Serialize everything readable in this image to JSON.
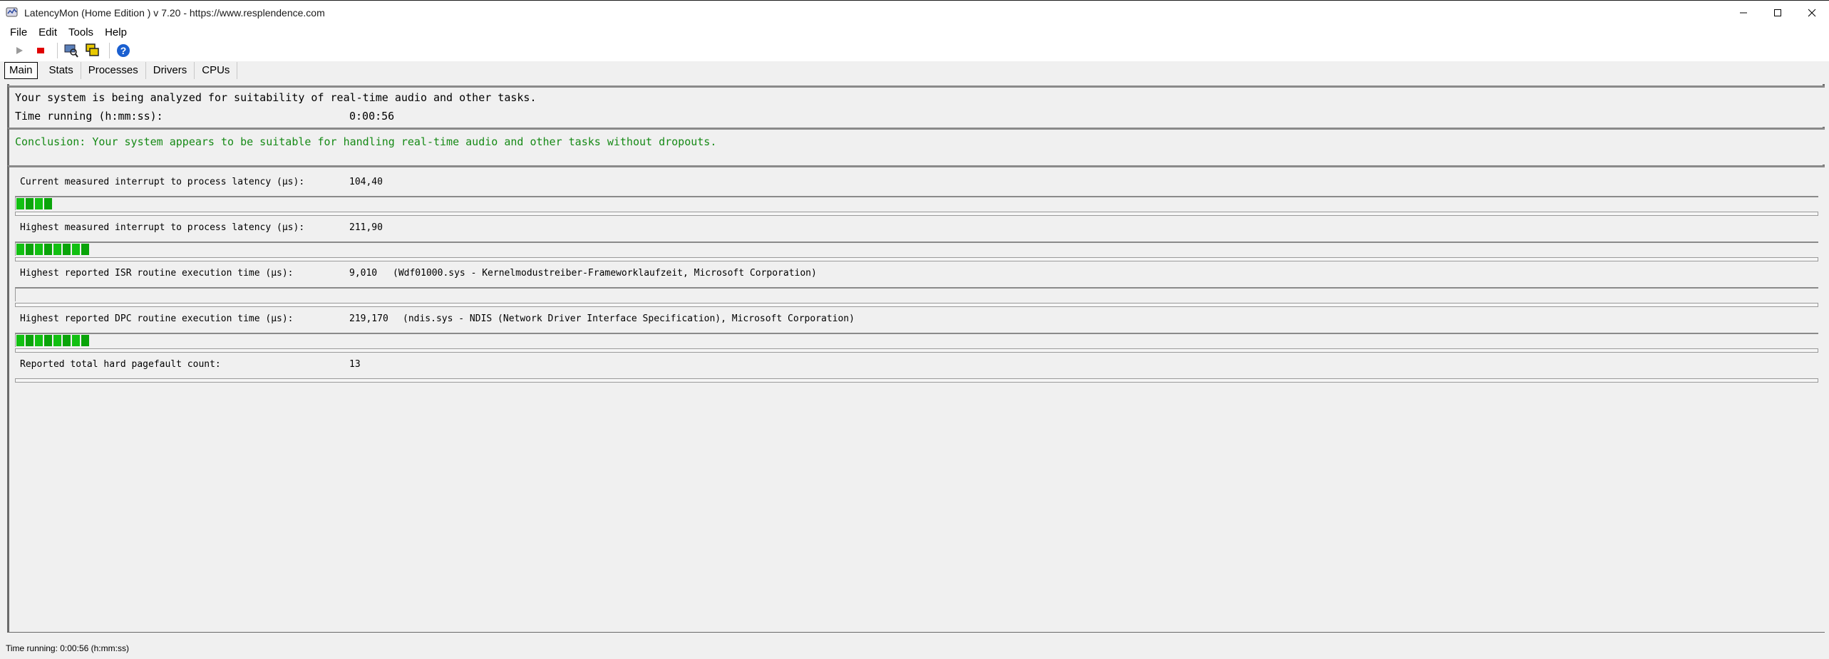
{
  "window": {
    "title": "LatencyMon  (Home Edition )  v 7.20 - https://www.resplendence.com",
    "app_icon": "latencymon-icon"
  },
  "menu": [
    "File",
    "Edit",
    "Tools",
    "Help"
  ],
  "toolbar": {
    "items": [
      "play-icon",
      "stop-icon",
      "monitor-icon",
      "windows-icon",
      "help-icon"
    ],
    "colors": {
      "stop": "#e00000",
      "help": "#1a5fd0"
    }
  },
  "tabs": [
    "Main",
    "Stats",
    "Processes",
    "Drivers",
    "CPUs"
  ],
  "main": {
    "status_line": "Your system is being analyzed for suitability of real-time audio and other tasks.",
    "time_label": "Time running (h:mm:ss):",
    "time_value": "0:00:56",
    "conclusion": "Conclusion: Your system appears to be suitable for handling real-time audio and other tasks without dropouts.",
    "conclusion_color": "#168a16",
    "metrics": [
      {
        "label": "Current measured interrupt to process latency (µs):",
        "value": "104,40",
        "detail": "",
        "segments": 4
      },
      {
        "label": "Highest measured interrupt to process latency (µs):",
        "value": "211,90",
        "detail": "",
        "segments": 8
      },
      {
        "label": "Highest reported ISR routine execution time (µs):",
        "value": "9,010",
        "detail": "(Wdf01000.sys - Kernelmodustreiber-Frameworklaufzeit, Microsoft Corporation)",
        "segments": 0
      },
      {
        "label": "Highest reported DPC routine execution time (µs):",
        "value": "219,170",
        "detail": "(ndis.sys - NDIS (Network Driver Interface Specification), Microsoft Corporation)",
        "segments": 8
      },
      {
        "label": "Reported total hard pagefault count:",
        "value": "13",
        "detail": "",
        "segments": 0
      }
    ],
    "meter_color": "#12c012"
  },
  "statusbar": {
    "text": "Time running: 0:00:56  (h:mm:ss)"
  }
}
